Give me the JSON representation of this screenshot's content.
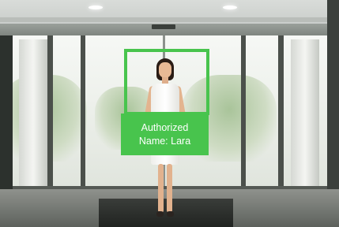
{
  "overlay": {
    "color": "#48c44d",
    "status_line": "Authorized",
    "name_line": "Name: Lara"
  },
  "scene": {
    "subject": "woman in white dress standing at entrance",
    "setting": "automatic sliding glass doors"
  }
}
